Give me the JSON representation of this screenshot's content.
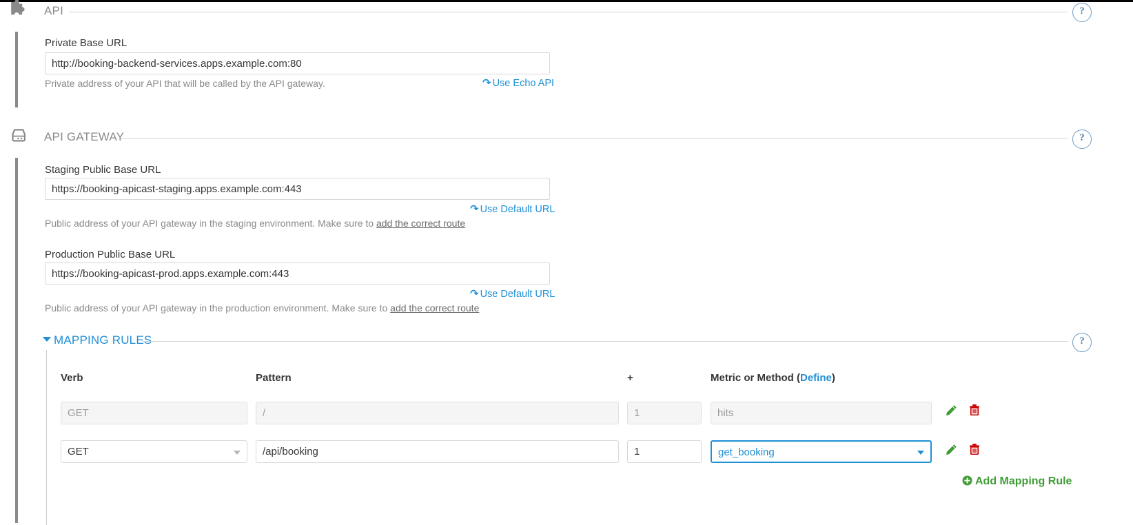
{
  "sections": {
    "api": {
      "title": "API",
      "icon": "puzzle-piece-icon",
      "help_badge": "?",
      "private_base_url": {
        "label": "Private Base URL",
        "value": "http://booking-backend-services.apps.example.com:80",
        "hint": "Private address of your API that will be called by the API gateway.",
        "reset_link": "Use Echo API",
        "reset_icon": "undo-icon"
      }
    },
    "api_gateway": {
      "title": "API GATEWAY",
      "icon": "server-icon",
      "help_badge": "?",
      "staging": {
        "label": "Staging Public Base URL",
        "value": "https://booking-apicast-staging.apps.example.com:443",
        "reset_link": "Use Default URL",
        "reset_icon": "undo-icon",
        "hint_text": "Public address of your API gateway in the staging environment. Make sure to ",
        "hint_link": "add the correct route"
      },
      "production": {
        "label": "Production Public Base URL",
        "value": "https://booking-apicast-prod.apps.example.com:443",
        "reset_link": "Use Default URL",
        "reset_icon": "undo-icon",
        "hint_text": "Public address of your API gateway in the production environment. Make sure to ",
        "hint_link": "add the correct route"
      }
    },
    "mapping_rules": {
      "title": "MAPPING RULES",
      "caret": "caret-down-icon",
      "help_badge": "?",
      "columns": {
        "verb": "Verb",
        "pattern": "Pattern",
        "plus": "+",
        "metric_prefix": "Metric or Method (",
        "metric_define": "Define",
        "metric_suffix": ")"
      },
      "rows": [
        {
          "state": "placeholder",
          "verb": "GET",
          "pattern": "/",
          "delta": "1",
          "metric": "hits",
          "edit_icon": "pencil-icon",
          "delete_icon": "trash-icon"
        },
        {
          "state": "active",
          "verb": "GET",
          "pattern": "/api/booking",
          "delta": "1",
          "metric": "get_booking",
          "edit_icon": "pencil-icon",
          "delete_icon": "trash-icon"
        }
      ],
      "add_rule_label": "Add Mapping Rule",
      "add_rule_icon": "plus-circle-icon"
    }
  },
  "colors": {
    "accent_blue": "#1f8fd6",
    "green": "#3f9c35",
    "red": "#cc0000",
    "muted": "#8a8a8a"
  }
}
